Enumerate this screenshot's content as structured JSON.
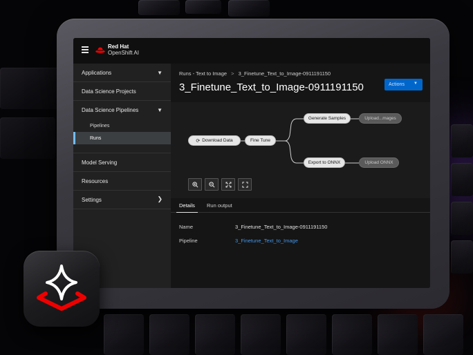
{
  "masthead": {
    "brand_line1": "Red Hat",
    "brand_line2": "OpenShift AI"
  },
  "sidebar": {
    "items": [
      {
        "label": "Applications",
        "chevron": "chevron-down-icon"
      },
      {
        "label": "Data Science Projects"
      },
      {
        "label": "Data Science Pipelines",
        "chevron": "chevron-down-icon"
      },
      {
        "label": "Model Serving"
      },
      {
        "label": "Resources"
      },
      {
        "label": "Settings",
        "chevron": "chevron-right-icon"
      }
    ],
    "subitems": [
      {
        "label": "Pipelines"
      },
      {
        "label": "Runs",
        "active": true
      }
    ]
  },
  "breadcrumb": {
    "parent": "Runs - Text to Image",
    "separator": ">",
    "current": "3_Finetune_Text_to_Image-0911191150"
  },
  "page_title": "3_Finetune_Text_to_Image-0911191150",
  "actions_label": "Actions",
  "graph": {
    "nodes": {
      "download": "Download Data",
      "finetune": "Fine Tune",
      "generate": "Generate Samples",
      "upload_images": "Upload...mages",
      "export": "Export to ONNX",
      "upload_onnx": "Upload ONNX"
    },
    "controls": [
      "zoom-in-icon",
      "zoom-out-icon",
      "fit-to-screen-icon",
      "reset-view-icon"
    ]
  },
  "tabs": [
    {
      "label": "Details",
      "active": true
    },
    {
      "label": "Run output"
    }
  ],
  "details": {
    "name_label": "Name",
    "name_value": "3_Finetune_Text_to_Image-0911191150",
    "pipeline_label": "Pipeline",
    "pipeline_value": "3_Finetune_Text_to_Image"
  },
  "colors": {
    "accent": "#0066cc",
    "link": "#4394e5",
    "brand_red": "#ee0000",
    "active_nav": "#73bcf7"
  }
}
